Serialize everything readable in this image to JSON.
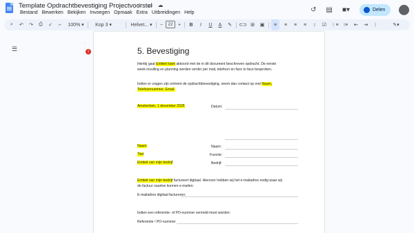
{
  "app": {
    "doc_title": "Template Opdrachtbevestiging Projectvoorstel",
    "menu": [
      "Bestand",
      "Bewerken",
      "Bekijken",
      "Invoegen",
      "Opmaak",
      "Extra",
      "Uitbreidingen",
      "Help"
    ],
    "share_label": "Delen"
  },
  "toolbar": {
    "zoom": "100%",
    "style": "Kop 3",
    "font": "Helvet...",
    "font_size": "22",
    "bold": "B",
    "italic": "I",
    "underline": "U",
    "text_color": "A"
  },
  "ruler": {
    "marker_label": "1"
  },
  "doc": {
    "heading": "5. Bevestiging",
    "intro_1a": "Hierbij gaat ",
    "intro_1_hl": "Entiteit klant",
    "intro_1b": " akkoord met de in dit document beschreven opdracht. De eerste",
    "intro_2": "week invulling en planning worden verder per mail, telefoon en face to face besproken.",
    "contact_1a": "Indien er vragen zijn omtrent de opdrachtbevestiging, neem dan contact op met ",
    "contact_1_hl": "Naam,",
    "contact_2_hl": "Telefoonnummer, Email.",
    "date_value": "Amsterdam, 1 december 2025",
    "date_label": "Datum:",
    "left_name": "Naam",
    "left_title": "Titel",
    "left_company": "Entiteit van mijn bedrijf",
    "right_name": "Naam:",
    "right_function": "Functie:",
    "right_company": "Bedrijf:",
    "invoice_hl": "Entiteit van mijn bedrijf",
    "invoice_1b": " factureert digitaal. Hiervoor hebben wij het e-mailadres nodig waar wij",
    "invoice_2": "de factuur naartoe kunnen e-mailen:",
    "email_label": "E-mailadres digitaal factureren:",
    "po_text": "Indien een referentie- of PO-nummer vermeld moet worden:",
    "po_label": "Referentie / PO-nummer"
  }
}
